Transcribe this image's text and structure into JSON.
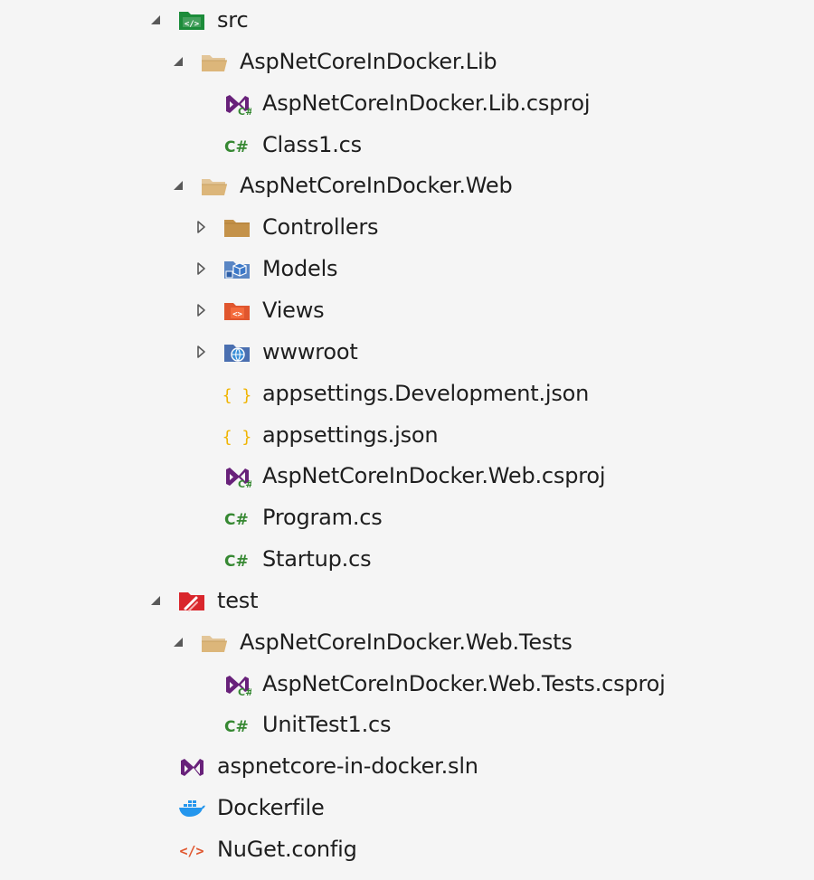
{
  "tree": {
    "items": [
      {
        "label": "src",
        "depth": 0,
        "expander": "expanded",
        "icon": "solution-folder-src-icon"
      },
      {
        "label": "AspNetCoreInDocker.Lib",
        "depth": 1,
        "expander": "expanded",
        "icon": "folder-open-icon"
      },
      {
        "label": "AspNetCoreInDocker.Lib.csproj",
        "depth": 2,
        "expander": "none",
        "icon": "csproj-icon"
      },
      {
        "label": "Class1.cs",
        "depth": 2,
        "expander": "none",
        "icon": "csharp-file-icon"
      },
      {
        "label": "AspNetCoreInDocker.Web",
        "depth": 1,
        "expander": "expanded",
        "icon": "folder-open-icon"
      },
      {
        "label": "Controllers",
        "depth": 2,
        "expander": "collapsed",
        "icon": "folder-icon"
      },
      {
        "label": "Models",
        "depth": 2,
        "expander": "collapsed",
        "icon": "models-folder-icon"
      },
      {
        "label": "Views",
        "depth": 2,
        "expander": "collapsed",
        "icon": "views-folder-icon"
      },
      {
        "label": "wwwroot",
        "depth": 2,
        "expander": "collapsed",
        "icon": "wwwroot-icon"
      },
      {
        "label": "appsettings.Development.json",
        "depth": 2,
        "expander": "none",
        "icon": "json-file-icon"
      },
      {
        "label": "appsettings.json",
        "depth": 2,
        "expander": "none",
        "icon": "json-file-icon"
      },
      {
        "label": "AspNetCoreInDocker.Web.csproj",
        "depth": 2,
        "expander": "none",
        "icon": "csproj-icon"
      },
      {
        "label": "Program.cs",
        "depth": 2,
        "expander": "none",
        "icon": "csharp-file-icon"
      },
      {
        "label": "Startup.cs",
        "depth": 2,
        "expander": "none",
        "icon": "csharp-file-icon"
      },
      {
        "label": "test",
        "depth": 0,
        "expander": "expanded",
        "icon": "solution-folder-test-icon"
      },
      {
        "label": "AspNetCoreInDocker.Web.Tests",
        "depth": 1,
        "expander": "expanded",
        "icon": "folder-open-icon"
      },
      {
        "label": "AspNetCoreInDocker.Web.Tests.csproj",
        "depth": 2,
        "expander": "none",
        "icon": "csproj-icon"
      },
      {
        "label": "UnitTest1.cs",
        "depth": 2,
        "expander": "none",
        "icon": "csharp-file-icon"
      },
      {
        "label": "aspnetcore-in-docker.sln",
        "depth": 0,
        "expander": "none",
        "icon": "vs-solution-icon"
      },
      {
        "label": "Dockerfile",
        "depth": 0,
        "expander": "none",
        "icon": "docker-icon"
      },
      {
        "label": "NuGet.config",
        "depth": 0,
        "expander": "none",
        "icon": "config-file-icon"
      }
    ]
  },
  "colors": {
    "background": "#f5f5f5",
    "text": "#1e1e1e",
    "expander": "#595959",
    "csharp_green": "#368832",
    "vs_purple": "#68217a",
    "folder_tan": "#dcb67a",
    "folder_brown": "#c4924a",
    "json_yellow": "#f0b400",
    "src_green": "#1c8c3a",
    "test_red": "#d9262c",
    "models_blue": "#3c78c8",
    "views_orange": "#e0562e",
    "docker_blue": "#2496ed",
    "config_orange": "#e0562e"
  }
}
